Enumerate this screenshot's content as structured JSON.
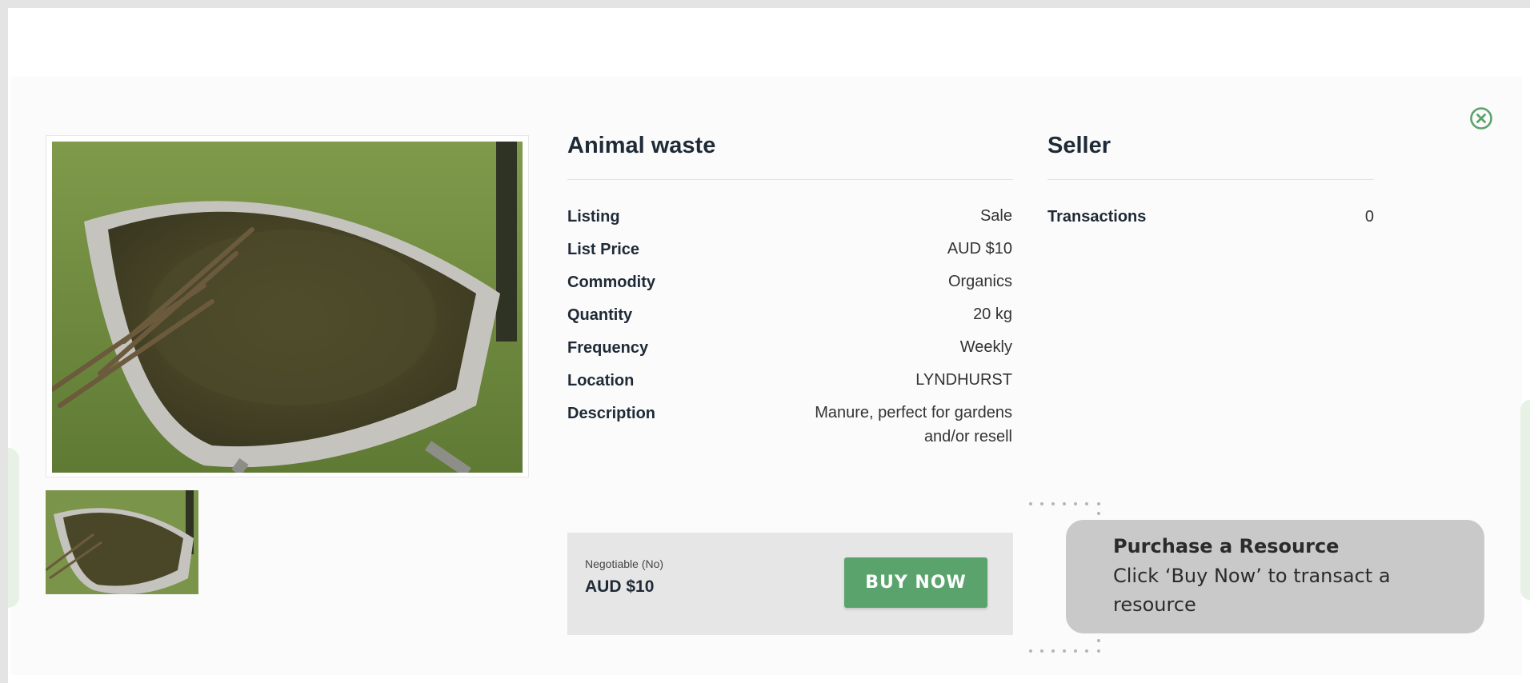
{
  "listing": {
    "title": "Animal waste",
    "details": [
      {
        "label": "Listing",
        "value": "Sale"
      },
      {
        "label": "List Price",
        "value": "AUD $10"
      },
      {
        "label": "Commodity",
        "value": "Organics"
      },
      {
        "label": "Quantity",
        "value": "20 kg"
      },
      {
        "label": "Frequency",
        "value": "Weekly"
      },
      {
        "label": "Location",
        "value": "LYNDHURST"
      },
      {
        "label": "Description",
        "value": "Manure, perfect for gardens",
        "value_line2": "and/or resell"
      }
    ]
  },
  "seller": {
    "title": "Seller",
    "transactions_label": "Transactions",
    "transactions_value": "0"
  },
  "purchase": {
    "negotiable_label": "Negotiable (No)",
    "price": "AUD $10",
    "buy_label": "BUY NOW"
  },
  "tooltip": {
    "title": "Purchase a Resource",
    "body": "Click ‘Buy Now’ to transact a resource"
  },
  "icons": {
    "close": "close-circle-icon"
  },
  "colors": {
    "accent_green": "#5ba36d",
    "heading": "#1f2a37",
    "tooltip_bg": "#c9c9c9"
  }
}
